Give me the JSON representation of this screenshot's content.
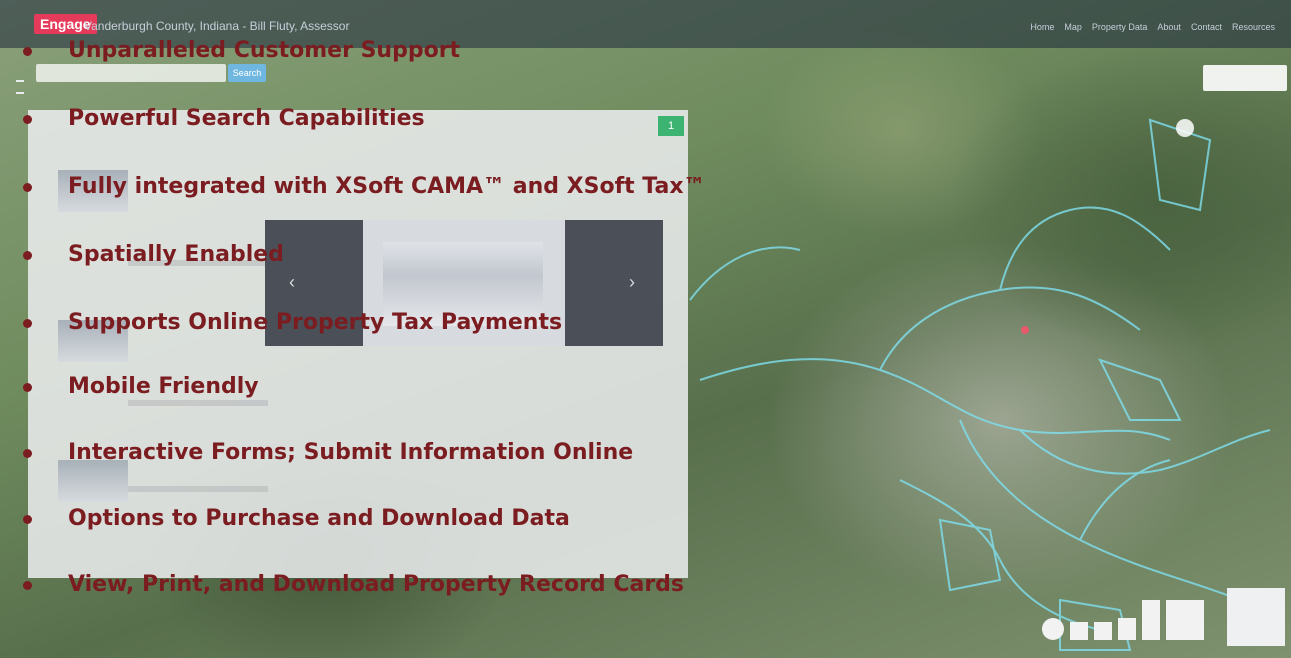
{
  "app": {
    "badge": "Engage",
    "title": "Vanderburgh County, Indiana - Bill Fluty, Assessor",
    "nav": [
      "Home",
      "Map",
      "Property Data",
      "About",
      "Contact",
      "Resources"
    ],
    "search_button": "Search"
  },
  "panel": {
    "tag": "1"
  },
  "colors": {
    "bullet_text": "#7b1c20",
    "engage_badge": "#e53b5a",
    "parcel_lines": "#7fe0f0"
  },
  "features": [
    "Unparalleled Customer Support",
    "Powerful Search Capabilities",
    "Fully integrated with XSoft CAMA™ and XSoft Tax™",
    "Spatially Enabled",
    "Supports Online Property Tax Payments",
    "Mobile Friendly",
    "Interactive Forms; Submit Information Online",
    "Options to Purchase and Download Data",
    "View, Print, and Download Property Record Cards"
  ]
}
